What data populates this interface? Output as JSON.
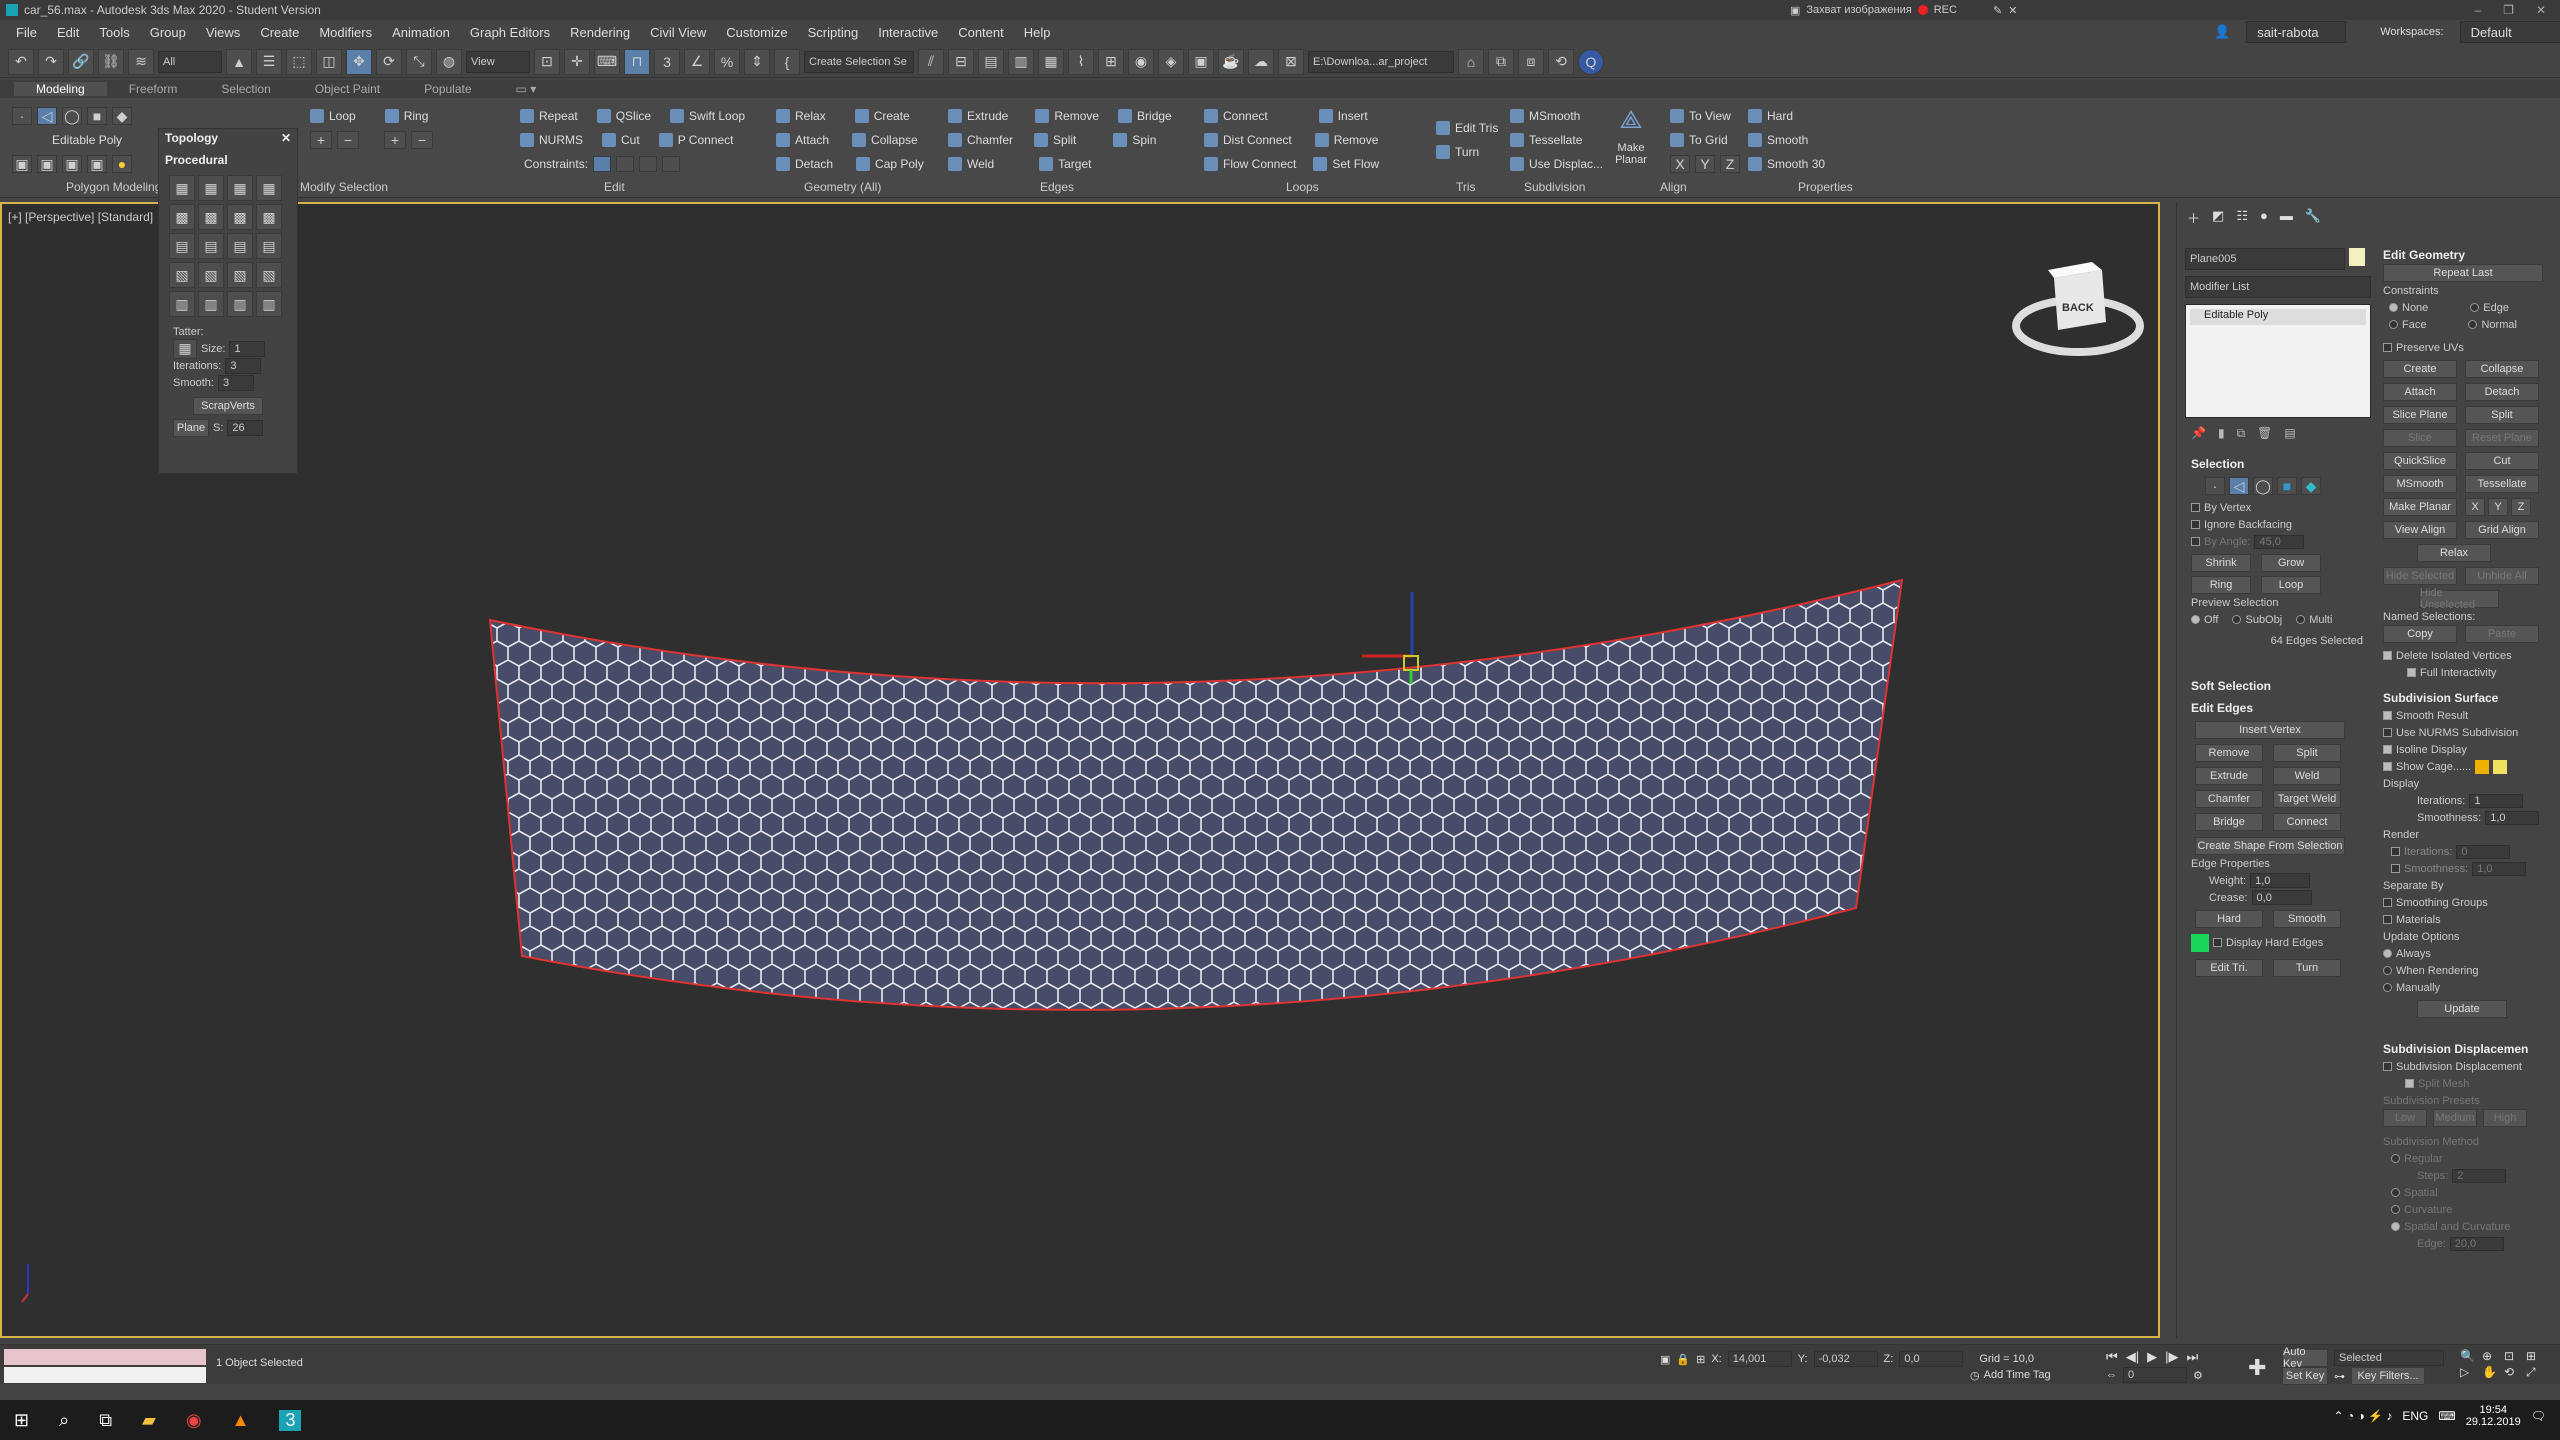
{
  "window": {
    "title": "car_56.max - Autodesk 3ds Max 2020 - Student Version",
    "rec_label": "Захват изображения",
    "rec": "REC",
    "user": "sait-rabota",
    "workspace_label": "Workspaces:",
    "workspace": "Default"
  },
  "menu": [
    "File",
    "Edit",
    "Tools",
    "Group",
    "Views",
    "Create",
    "Modifiers",
    "Animation",
    "Graph Editors",
    "Rendering",
    "Civil View",
    "Customize",
    "Scripting",
    "Interactive",
    "Content",
    "Help"
  ],
  "toolbar": {
    "filter": "All",
    "refcoord": "View",
    "selset": "Create Selection Se",
    "path": "E:\\Downloa...ar_project"
  },
  "ribbon_tabs": [
    "Modeling",
    "Freeform",
    "Selection",
    "Object Paint",
    "Populate"
  ],
  "ribbon": {
    "polymod": "Editable Poly",
    "polymod_group": "Polygon Modeling",
    "modsel_group": "Modify Selection",
    "loop": "Loop",
    "ring": "Ring",
    "edit": [
      "Repeat",
      "QSlice",
      "Swift Loop",
      "NURMS",
      "Cut",
      "P Connect"
    ],
    "constraints": "Constraints:",
    "edit_group": "Edit",
    "geometry": [
      "Relax",
      "Create",
      "Attach",
      "Collapse",
      "Detach",
      "Cap Poly"
    ],
    "geometry_group": "Geometry (All)",
    "edges": [
      "Extrude",
      "Remove",
      "Bridge",
      "Chamfer",
      "Split",
      "Spin",
      "Weld",
      "Target"
    ],
    "edges_group": "Edges",
    "loops": [
      "Connect",
      "Insert",
      "Dist Connect",
      "Remove",
      "Flow Connect",
      "Set Flow"
    ],
    "loops_group": "Loops",
    "tris": [
      "Edit Tris",
      "Turn"
    ],
    "tris_group": "Tris",
    "subdiv": [
      "MSmooth",
      "Tessellate",
      "Use Displac..."
    ],
    "make_planar": "Make Planar",
    "subdiv_group": "Subdivision",
    "align": [
      "To View",
      "To Grid"
    ],
    "xyz": [
      "X",
      "Y",
      "Z"
    ],
    "align_group": "Align",
    "props": [
      "Hard",
      "Smooth",
      "Smooth 30"
    ],
    "props_group": "Properties"
  },
  "topology": {
    "title": "Topology",
    "section": "Procedural",
    "tatter": "Tatter:",
    "size_label": "Size:",
    "size": "1",
    "iter_label": "Iterations:",
    "iter": "3",
    "smooth_label": "Smooth:",
    "smooth": "3",
    "scrap": "ScrapVerts",
    "plane": "Plane",
    "s_label": "S:",
    "s": "26"
  },
  "viewport": {
    "label": "[+] [Perspective] [Standard]",
    "cube": "BACK"
  },
  "cmd": {
    "object": "Plane005",
    "modlist": "Modifier List",
    "stack": "Editable Poly",
    "selection_title": "Selection",
    "by_vertex": "By Vertex",
    "ignore_backfacing": "Ignore Backfacing",
    "by_angle": "By Angle:",
    "angle": "45,0",
    "shrink": "Shrink",
    "grow": "Grow",
    "ring": "Ring",
    "loop": "Loop",
    "preview": "Preview Selection",
    "prev_opts": [
      "Off",
      "SubObj",
      "Multi"
    ],
    "edges_selected": "64 Edges Selected",
    "soft": "Soft Selection",
    "edit_edges": "Edit Edges",
    "insert_vertex": "Insert Vertex",
    "remove": "Remove",
    "split": "Split",
    "extrude": "Extrude",
    "weld": "Weld",
    "chamfer": "Chamfer",
    "target_weld": "Target Weld",
    "bridge": "Bridge",
    "connect": "Connect",
    "create_shape": "Create Shape From Selection",
    "edge_props": "Edge Properties",
    "weight_label": "Weight:",
    "weight": "1,0",
    "crease_label": "Crease:",
    "crease": "0,0",
    "hard": "Hard",
    "smooth": "Smooth",
    "display_hard": "Display Hard Edges",
    "edit_tri": "Edit Tri.",
    "turn": "Turn",
    "eg_title": "Edit Geometry",
    "repeat_last": "Repeat Last",
    "constraints": "Constraints",
    "con_opts": [
      "None",
      "Edge",
      "Face",
      "Normal"
    ],
    "preserve_uvs": "Preserve UVs",
    "eg_btns": [
      "Create",
      "Collapse",
      "Attach",
      "Detach",
      "Slice Plane",
      "Split",
      "Slice",
      "Reset Plane",
      "QuickSlice",
      "Cut",
      "MSmooth",
      "Tessellate",
      "Make Planar",
      "View Align",
      "Grid Align",
      "Relax",
      "Hide Selected",
      "Unhide All",
      "Hide Unselected"
    ],
    "xyz": [
      "X",
      "Y",
      "Z"
    ],
    "named_sel": "Named Selections:",
    "copy": "Copy",
    "paste": "Paste",
    "del_iso": "Delete Isolated Vertices",
    "full_int": "Full Interactivity",
    "subsurf_title": "Subdivision Surface",
    "smooth_result": "Smooth Result",
    "use_nurms": "Use NURMS Subdivision",
    "isoline": "Isoline Display",
    "show_cage": "Show Cage......",
    "display": "Display",
    "iterations_label": "Iterations:",
    "iterations": "1",
    "smoothness_label": "Smoothness:",
    "smoothness": "1,0",
    "render": "Render",
    "r_iterations": "0",
    "r_smoothness": "1,0",
    "sep_by": "Separate By",
    "smoothing_groups": "Smoothing Groups",
    "materials": "Materials",
    "update_opts": "Update Options",
    "always": "Always",
    "when_rendering": "When Rendering",
    "manually": "Manually",
    "update": "Update",
    "subdisp_title": "Subdivision Displacemen",
    "subdisp": "Subdivision Displacement",
    "split_mesh": "Split Mesh",
    "presets": "Subdivision Presets",
    "low": "Low",
    "medium": "Medium",
    "high": "High",
    "method": "Subdivision Method",
    "regular": "Regular",
    "steps_label": "Steps:",
    "steps": "2",
    "spatial": "Spatial",
    "curvature": "Curvature",
    "spatial_curv": "Spatial and Curvature",
    "edge_label": "Edge:",
    "edge": "20,0"
  },
  "status": {
    "selected": "1 Object Selected",
    "x_label": "X:",
    "x": "14,001",
    "y_label": "Y:",
    "y": "-0,032",
    "z_label": "Z:",
    "z": "0,0",
    "grid": "Grid = 10,0",
    "add_time_tag": "Add Time Tag",
    "auto_key": "Auto Key",
    "selected_dd": "Selected",
    "set_key": "Set Key",
    "key_filters": "Key Filters...",
    "frame": "0"
  },
  "taskbar": {
    "lang": "ENG",
    "time": "19:54",
    "date": "29.12.2019"
  }
}
